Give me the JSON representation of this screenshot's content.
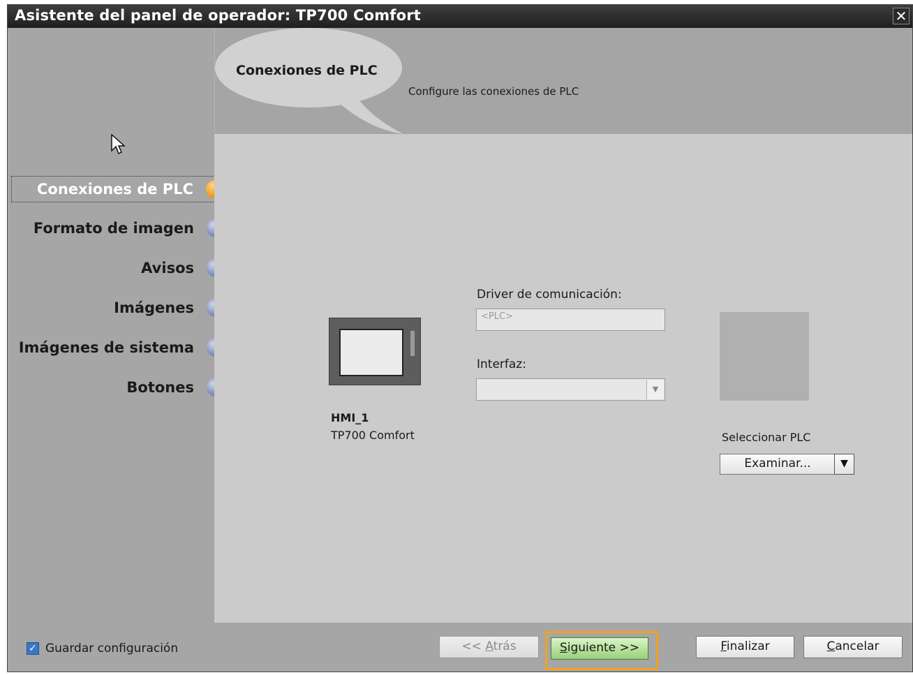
{
  "window": {
    "title": "Asistente del panel de operador: TP700 Comfort",
    "close_label": "✕"
  },
  "header": {
    "title": "Conexiones de PLC",
    "subtitle": "Configure las conexiones de PLC"
  },
  "sidebar": {
    "items": [
      {
        "label": "Conexiones de PLC",
        "state": "active",
        "dot_color": "#f4a020"
      },
      {
        "label": "Formato de imagen",
        "state": "pending",
        "dot_color": "#8392c0"
      },
      {
        "label": "Avisos",
        "state": "pending",
        "dot_color": "#8392c0"
      },
      {
        "label": "Imágenes",
        "state": "pending",
        "dot_color": "#8392c0"
      },
      {
        "label": "Imágenes de sistema",
        "state": "pending",
        "dot_color": "#8392c0"
      },
      {
        "label": "Botones",
        "state": "pending",
        "dot_color": "#8392c0"
      }
    ]
  },
  "device": {
    "name": "HMI_1",
    "model": "TP700 Comfort",
    "image_icon": "hmi-panel-icon"
  },
  "form": {
    "driver_label": "Driver de comunicación:",
    "driver_value": "<PLC>",
    "interface_label": "Interfaz:",
    "interface_value": ""
  },
  "plc": {
    "select_label": "Seleccionar PLC",
    "browse_label": "Examinar...",
    "dropdown_icon": "triangle-down-icon"
  },
  "footer": {
    "save_config_label": "Guardar configuración",
    "save_config_checked": true,
    "back": {
      "prefix": "<< ",
      "mnemonic": "A",
      "rest": "trás",
      "enabled": false
    },
    "next": {
      "mnemonic": "S",
      "rest": "iguiente >>",
      "highlight_color": "#f0a21f"
    },
    "finish": {
      "mnemonic": "F",
      "rest": "inalizar"
    },
    "cancel": {
      "mnemonic": "C",
      "rest": "ancelar"
    }
  }
}
